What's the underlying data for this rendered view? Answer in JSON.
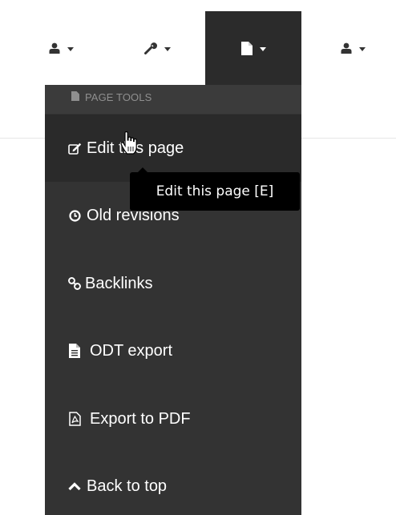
{
  "navbar": {
    "items": [
      {
        "icon": "user-icon"
      },
      {
        "icon": "wrench-icon"
      },
      {
        "icon": "file-icon",
        "active": true
      },
      {
        "icon": "user-icon"
      }
    ]
  },
  "dropdown": {
    "header": "PAGE TOOLS",
    "items": [
      {
        "label": "Edit this page",
        "icon": "edit-icon"
      },
      {
        "label": "Old revisions",
        "icon": "clock-icon"
      },
      {
        "label": "Backlinks",
        "icon": "link-icon"
      },
      {
        "label": "ODT export",
        "icon": "document-icon"
      },
      {
        "label": "Export to PDF",
        "icon": "pdf-icon"
      },
      {
        "label": "Back to top",
        "icon": "chevron-up-icon"
      }
    ]
  },
  "tooltip": {
    "text": "Edit this page [E]"
  },
  "colors": {
    "dropdown_bg": "#333333",
    "navbar_active_bg": "#2b2b2b",
    "tooltip_bg": "#000000"
  }
}
